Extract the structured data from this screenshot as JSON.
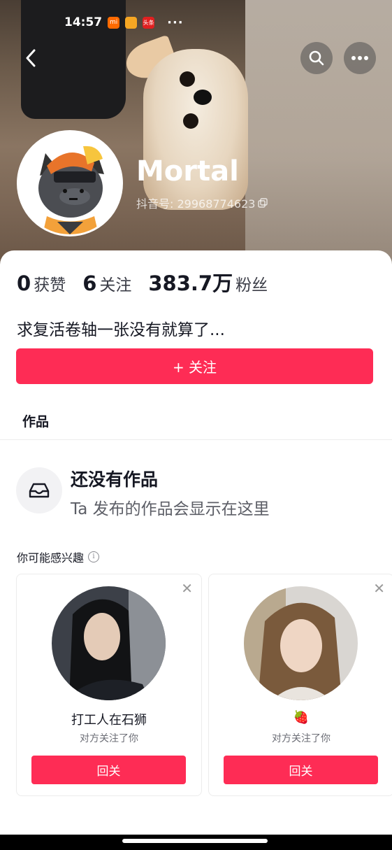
{
  "status_bar": {
    "time": "14:57",
    "app_badge": "头条",
    "more": "···"
  },
  "profile": {
    "name": "Mortal",
    "douyin_id": "抖音号: 29968774623",
    "bio": "求复活卷轴一张没有就算了..."
  },
  "stats": [
    {
      "value": "0",
      "label": "获赞"
    },
    {
      "value": "6",
      "label": "关注"
    },
    {
      "value": "383.7万",
      "label": "粉丝"
    }
  ],
  "follow_button": "+ 关注",
  "tabs": {
    "works": "作品"
  },
  "empty_state": {
    "title": "还没有作品",
    "subtitle": "Ta 发布的作品会显示在这里"
  },
  "recommend": {
    "title": "你可能感兴趣",
    "cards": [
      {
        "name": "打工人在石狮",
        "subtitle": "对方关注了你",
        "button": "回关"
      },
      {
        "name": "🍓",
        "subtitle": "对方关注了你",
        "button": "回关"
      }
    ]
  },
  "colors": {
    "accent": "#fe2c55",
    "text": "#161823"
  }
}
